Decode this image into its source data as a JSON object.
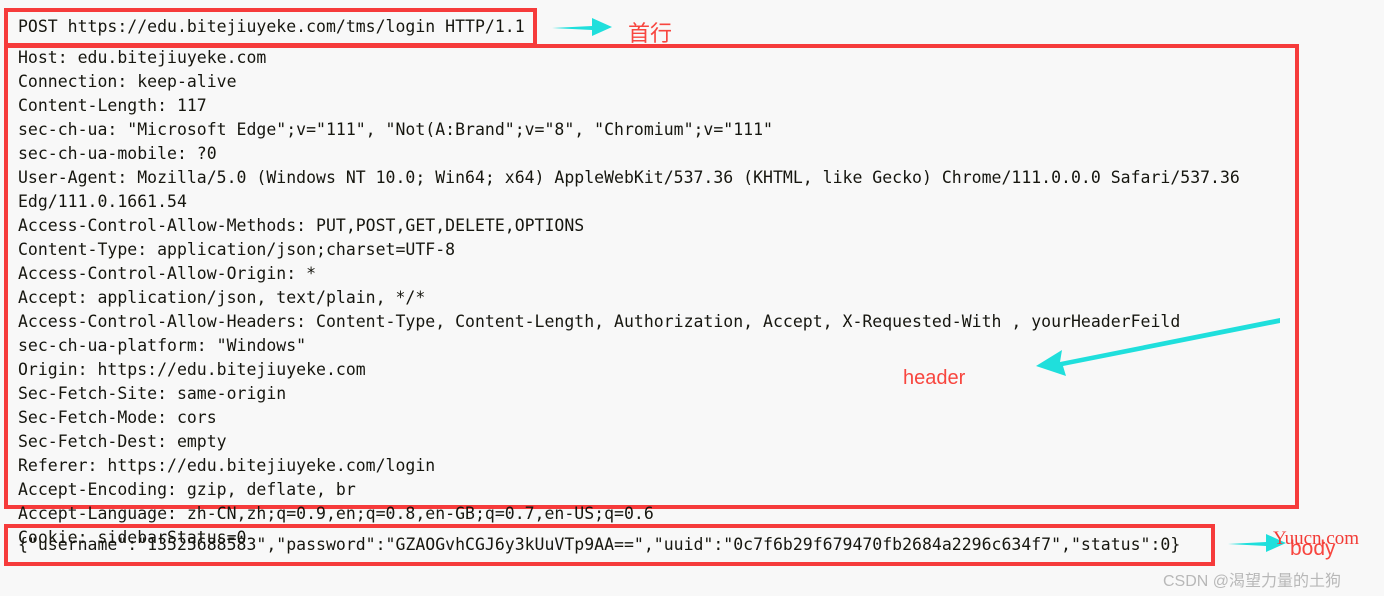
{
  "request": {
    "first_line": "POST https://edu.bitejiuyeke.com/tms/login HTTP/1.1",
    "headers": [
      "Host: edu.bitejiuyeke.com",
      "Connection: keep-alive",
      "Content-Length: 117",
      "sec-ch-ua: \"Microsoft Edge\";v=\"111\", \"Not(A:Brand\";v=\"8\", \"Chromium\";v=\"111\"",
      "sec-ch-ua-mobile: ?0",
      "User-Agent: Mozilla/5.0 (Windows NT 10.0; Win64; x64) AppleWebKit/537.36 (KHTML, like Gecko) Chrome/111.0.0.0 Safari/537.36",
      "Edg/111.0.1661.54",
      "Access-Control-Allow-Methods: PUT,POST,GET,DELETE,OPTIONS",
      "Content-Type: application/json;charset=UTF-8",
      "Access-Control-Allow-Origin: *",
      "Accept: application/json, text/plain, */*",
      "Access-Control-Allow-Headers: Content-Type, Content-Length, Authorization, Accept, X-Requested-With , yourHeaderFeild",
      "sec-ch-ua-platform: \"Windows\"",
      "Origin: https://edu.bitejiuyeke.com",
      "Sec-Fetch-Site: same-origin",
      "Sec-Fetch-Mode: cors",
      "Sec-Fetch-Dest: empty",
      "Referer: https://edu.bitejiuyeke.com/login",
      "Accept-Encoding: gzip, deflate, br",
      "Accept-Language: zh-CN,zh;q=0.9,en;q=0.8,en-GB;q=0.7,en-US;q=0.6",
      "Cookie: sidebarStatus=0"
    ],
    "body": "{\"username\":\"13525688583\",\"password\":\"GZAOGvhCGJ6y3kUuVTp9AA==\",\"uuid\":\"0c7f6b29f679470fb2684a2296c634f7\",\"status\":0}"
  },
  "annotations": {
    "first_line_label": "首行",
    "header_label": "header",
    "body_label": "body",
    "arrow_color": "#1fdfdc",
    "box_color": "#f63b3b",
    "label_color": "#f8463f"
  },
  "watermarks": {
    "site": "Yuucn.com",
    "csdn": "CSDN @渴望力量的土狗"
  }
}
